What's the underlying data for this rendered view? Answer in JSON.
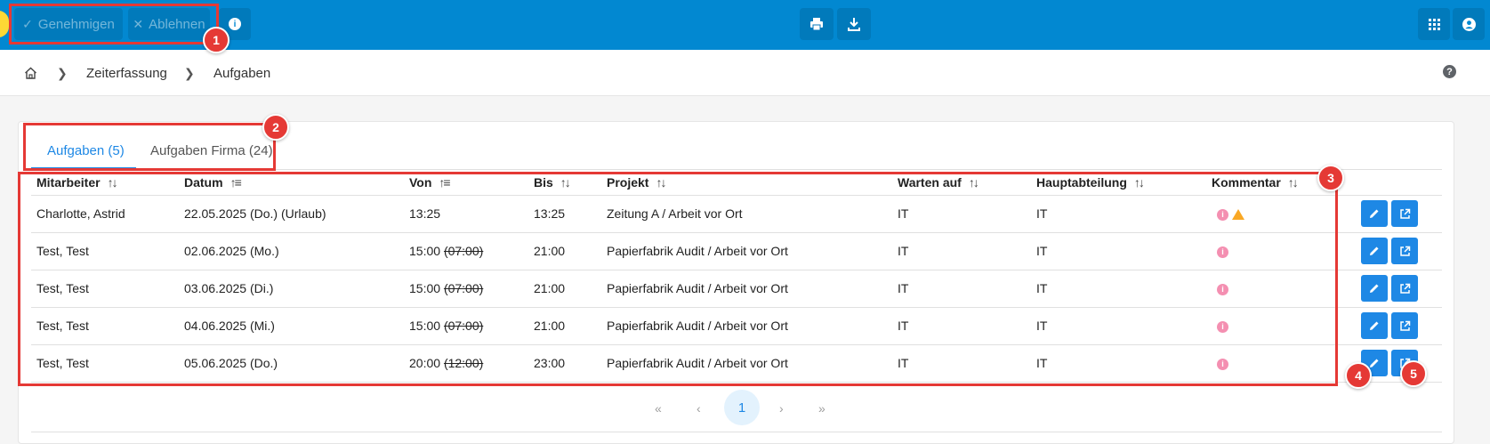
{
  "toolbar": {
    "approve_label": "Genehmigen",
    "reject_label": "Ablehnen"
  },
  "breadcrumb": {
    "items": [
      "Zeiterfassung",
      "Aufgaben"
    ]
  },
  "tabs": [
    {
      "label": "Aufgaben (5)",
      "active": true
    },
    {
      "label": "Aufgaben Firma (24)",
      "active": false
    }
  ],
  "table": {
    "columns": [
      "Mitarbeiter",
      "Datum",
      "Von",
      "Bis",
      "Projekt",
      "Warten auf",
      "Hauptabteilung",
      "Kommentar"
    ],
    "rows": [
      {
        "mitarbeiter": "Charlotte, Astrid",
        "datum": "22.05.2025 (Do.) (Urlaub)",
        "von": "13:25",
        "von_old": "",
        "bis": "13:25",
        "projekt": "Zeitung A / Arbeit vor Ort",
        "warten_auf": "IT",
        "hauptabteilung": "IT",
        "warning": true
      },
      {
        "mitarbeiter": "Test, Test",
        "datum": "02.06.2025 (Mo.)",
        "von": "15:00",
        "von_old": "(07:00)",
        "bis": "21:00",
        "projekt": "Papierfabrik Audit / Arbeit vor Ort",
        "warten_auf": "IT",
        "hauptabteilung": "IT",
        "warning": false
      },
      {
        "mitarbeiter": "Test, Test",
        "datum": "03.06.2025 (Di.)",
        "von": "15:00",
        "von_old": "(07:00)",
        "bis": "21:00",
        "projekt": "Papierfabrik Audit / Arbeit vor Ort",
        "warten_auf": "IT",
        "hauptabteilung": "IT",
        "warning": false
      },
      {
        "mitarbeiter": "Test, Test",
        "datum": "04.06.2025 (Mi.)",
        "von": "15:00",
        "von_old": "(07:00)",
        "bis": "21:00",
        "projekt": "Papierfabrik Audit / Arbeit vor Ort",
        "warten_auf": "IT",
        "hauptabteilung": "IT",
        "warning": false
      },
      {
        "mitarbeiter": "Test, Test",
        "datum": "05.06.2025 (Do.)",
        "von": "20:00",
        "von_old": "(12:00)",
        "bis": "23:00",
        "projekt": "Papierfabrik Audit / Arbeit vor Ort",
        "warten_auf": "IT",
        "hauptabteilung": "IT",
        "warning": false
      }
    ]
  },
  "pagination": {
    "current_page": "1"
  },
  "annotations": [
    "1",
    "2",
    "3",
    "4",
    "5"
  ],
  "colors": {
    "topbar": "#0288d1",
    "accent": "#1e88e5",
    "annotation": "#e53935"
  }
}
